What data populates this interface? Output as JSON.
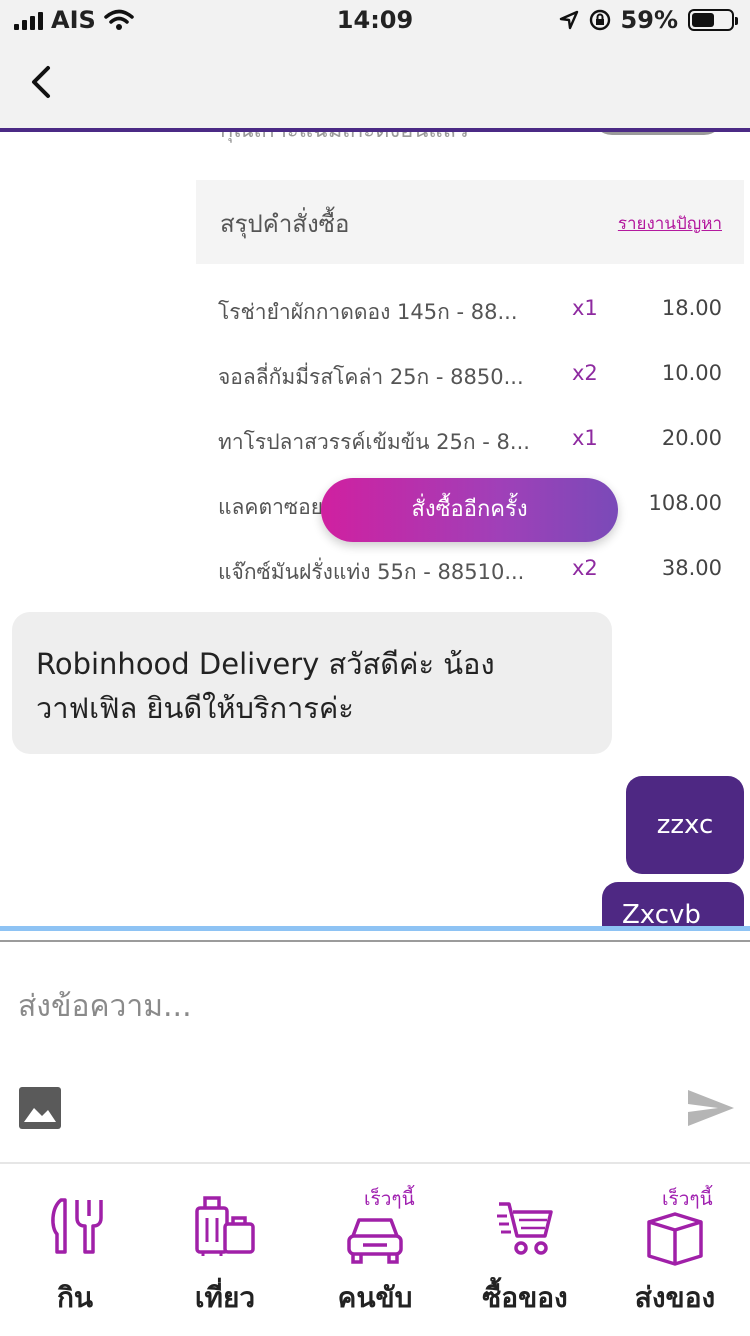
{
  "status": {
    "carrier": "AIS",
    "time": "14:09",
    "battery": "59%",
    "battery_level": 0.59
  },
  "nav": {
    "back_icon": "chevron-left-icon"
  },
  "chat": {
    "cut_text": "กุณเกาะแฉมเก่ะดงอนแล้ว",
    "order_summary": {
      "title": "สรุปคำสั่งซื้อ",
      "report_link": "รายงานปัญหา",
      "items": [
        {
          "name": "โรช่ายำผักกาดดอง 145ก - 88...",
          "qty": "x1",
          "price": "18.00"
        },
        {
          "name": "จอลลี่กัมมี่รสโคล่า 25ก - 8850...",
          "qty": "x2",
          "price": "10.00"
        },
        {
          "name": "ทาโรปลาสวรรค์เข้มข้น 25ก - 8...",
          "qty": "x1",
          "price": "20.00"
        },
        {
          "name": "แลคตาซอย",
          "qty": "",
          "price": "108.00"
        },
        {
          "name": "แจ๊กซ์มันฝรั่งแท่ง 55ก - 88510...",
          "qty": "x2",
          "price": "38.00"
        }
      ],
      "reorder_label": "สั่งซื้ออีกครั้ง"
    },
    "incoming_message": "Robinhood Delivery สวัสดีค่ะ  น้องวาฟเฟิล ยินดีให้บริการค่ะ",
    "outgoing_messages": [
      "zzxc",
      "Zxcvb"
    ]
  },
  "composer": {
    "placeholder": "ส่งข้อความ...",
    "image_icon": "image-icon",
    "send_icon": "send-icon"
  },
  "bottom_nav": {
    "items": [
      {
        "label": "กิน",
        "icon": "cutlery-icon",
        "tag": ""
      },
      {
        "label": "เที่ยว",
        "icon": "luggage-icon",
        "tag": ""
      },
      {
        "label": "คนขับ",
        "icon": "car-icon",
        "tag": "เร็วๆนี้"
      },
      {
        "label": "ซื้อของ",
        "icon": "cart-icon",
        "tag": ""
      },
      {
        "label": "ส่งของ",
        "icon": "box-icon",
        "tag": "เร็วๆนี้"
      }
    ]
  },
  "colors": {
    "brand_purple": "#4e2883",
    "accent_magenta": "#b3199e",
    "reorder_gradient": [
      "#d020a0",
      "#7a4ab8"
    ]
  }
}
